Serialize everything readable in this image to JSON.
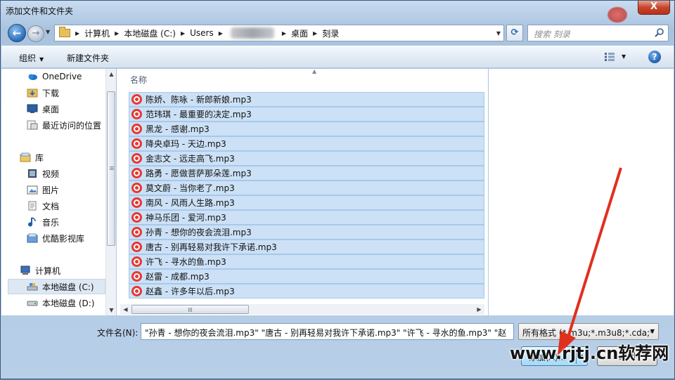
{
  "window": {
    "title": "添加文件和文件夹",
    "close_label": "X"
  },
  "nav": {
    "back_glyph": "←",
    "forward_glyph": "→",
    "breadcrumbs": [
      "计算机",
      "本地磁盘 (C:)",
      "Users",
      "桌面",
      "刻录"
    ],
    "search_placeholder": "搜索 刻录"
  },
  "toolbar": {
    "organize_label": "组织",
    "new_folder_label": "新建文件夹",
    "help_glyph": "?"
  },
  "sidebar": {
    "items": [
      {
        "label": "OneDrive",
        "icon": "cloud-icon"
      },
      {
        "label": "下载",
        "icon": "downloads-folder-icon"
      },
      {
        "label": "桌面",
        "icon": "desktop-icon"
      },
      {
        "label": "最近访问的位置",
        "icon": "recent-places-icon"
      },
      {
        "label": "库",
        "icon": "libraries-icon"
      },
      {
        "label": "视频",
        "icon": "video-icon"
      },
      {
        "label": "图片",
        "icon": "pictures-icon"
      },
      {
        "label": "文档",
        "icon": "documents-icon"
      },
      {
        "label": "音乐",
        "icon": "music-icon"
      },
      {
        "label": "优酷影视库",
        "icon": "youku-library-icon"
      },
      {
        "label": "计算机",
        "icon": "computer-icon"
      },
      {
        "label": "本地磁盘 (C:)",
        "icon": "drive-c-icon"
      },
      {
        "label": "本地磁盘 (D:)",
        "icon": "drive-d-icon"
      }
    ]
  },
  "files": {
    "column_header": "名称",
    "items": [
      "陈娇、陈咏 - 新郎新娘.mp3",
      "范玮琪 - 最重要的决定.mp3",
      "黑龙 - 感谢.mp3",
      "降央卓玛 - 天边.mp3",
      "金志文 - 远走高飞.mp3",
      "路勇 - 愿做菩萨那朵莲.mp3",
      "莫文蔚 - 当你老了.mp3",
      "南风 - 风雨人生路.mp3",
      "神马乐团 - 爱河.mp3",
      "孙青 - 想你的夜会流泪.mp3",
      "唐古 - 别再轻易对我许下承诺.mp3",
      "许飞 - 寻水的鱼.mp3",
      "赵雷 - 成都.mp3",
      "赵鑫 - 许多年以后.mp3"
    ]
  },
  "footer": {
    "filename_label": "文件名(N):",
    "filename_value": "\"孙青 - 想你的夜会流泪.mp3\" \"唐古 - 别再轻易对我许下承诺.mp3\" \"许飞 - 寻水的鱼.mp3\" \"赵",
    "format_value": "所有格式 (*.m3u;*.m3u8;*.cda;*",
    "add_label": "添加(A)...",
    "cancel_label": "关闭"
  },
  "watermark": "www.rjtj.cn软荐网",
  "colors": {
    "selection": "#cce1f6",
    "accent_arrow": "#e0301e",
    "mp3_icon": "#e53935"
  }
}
